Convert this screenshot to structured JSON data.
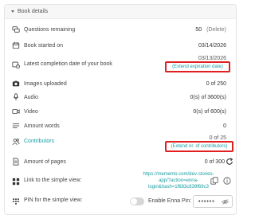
{
  "section": {
    "title": "Book details"
  },
  "rows": {
    "questions": {
      "label": "Questions remaining",
      "value": "50",
      "action": "(Delete)"
    },
    "started": {
      "label": "Book started on",
      "value": "03/14/2026"
    },
    "completion": {
      "label": "Latest completion date of your book",
      "value_partial": "03/13/2026",
      "action": "(Extend expiration date)"
    },
    "images": {
      "label": "Images uploaded",
      "value": "0 of 250"
    },
    "audio": {
      "label": "Audio",
      "value": "0(s) of 3600(s)"
    },
    "video": {
      "label": "Video",
      "value": "0(s) of 600(s)"
    },
    "words": {
      "label": "Amount words",
      "value": "0"
    },
    "contributors": {
      "label": "Contributors",
      "value_partial": "0 of 25",
      "action": "(Extend nr. of contributors)"
    },
    "pages": {
      "label": "Amount of pages",
      "value": "0 of 300"
    },
    "simple_view": {
      "label": "Link to the simple view:",
      "url": "https://memento.com/dev-stories-app/?action=enna-login&hash=1f683c839f69c3"
    },
    "pin": {
      "label": "PIN for the simple view:",
      "toggle_label": "Enable Enna Pin:",
      "pin_value": "••••••"
    }
  },
  "colors": {
    "accent": "#1a9ca0",
    "highlight": "#e02020"
  }
}
